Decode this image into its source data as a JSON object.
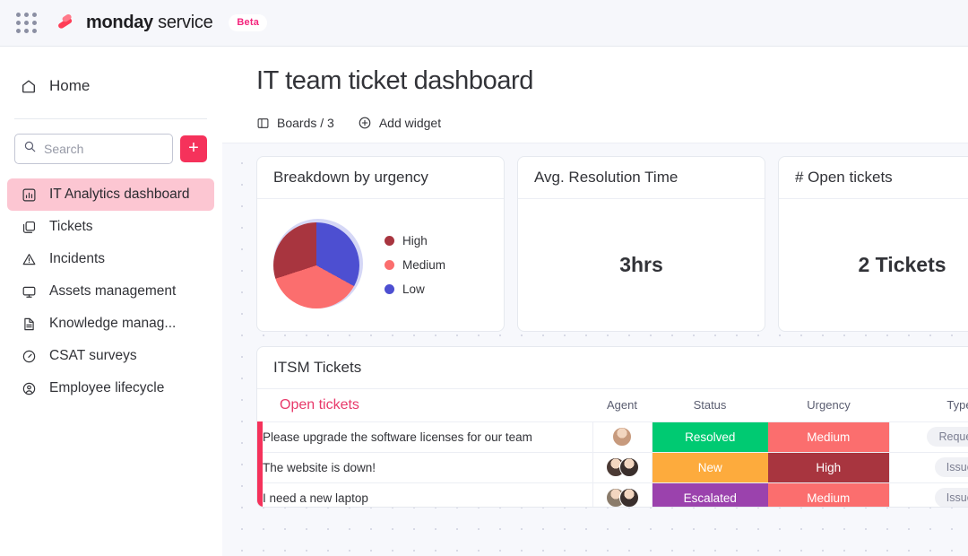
{
  "topbar": {
    "apps_icon": "app-grid-icon",
    "logo_icon": "monday-logo-icon",
    "brand_bold": "monday",
    "brand_light": " service",
    "beta_label": "Beta"
  },
  "sidebar": {
    "home": {
      "label": "Home",
      "icon": "home-icon"
    },
    "search": {
      "placeholder": "Search",
      "value": "",
      "icon": "search-icon"
    },
    "add_button": {
      "label": "+",
      "color": "#f5325b"
    },
    "items": [
      {
        "label": "IT Analytics dashboard",
        "icon": "bar-chart-icon",
        "active": true
      },
      {
        "label": "Tickets",
        "icon": "boards-stack-icon",
        "active": false
      },
      {
        "label": "Incidents",
        "icon": "warning-triangle-icon",
        "active": false
      },
      {
        "label": "Assets management",
        "icon": "monitor-icon",
        "active": false
      },
      {
        "label": "Knowledge manag...",
        "icon": "document-icon",
        "active": false
      },
      {
        "label": "CSAT surveys",
        "icon": "gauge-icon",
        "active": false
      },
      {
        "label": "Employee lifecycle",
        "icon": "person-circle-icon",
        "active": false
      }
    ]
  },
  "header": {
    "title": "IT team ticket dashboard",
    "tools": [
      {
        "label": "Boards / 3",
        "icon": "board-panel-icon"
      },
      {
        "label": "Add widget",
        "icon": "plus-circle-icon"
      }
    ]
  },
  "widgets": {
    "pie": {
      "title": "Breakdown by urgency"
    },
    "resolution": {
      "title": "Avg. Resolution Time",
      "value": "3hrs"
    },
    "open_tickets": {
      "title": "# Open tickets",
      "value": "2 Tickets"
    },
    "table": {
      "title": "ITSM Tickets"
    }
  },
  "chart_data": {
    "type": "pie",
    "title": "Breakdown by urgency",
    "labels": [
      "High",
      "Medium",
      "Low"
    ],
    "values": [
      30,
      37,
      33
    ],
    "colors": [
      "#a8353f",
      "#fb6e6e",
      "#4d4fd1"
    ],
    "legend_position": "right",
    "start_angle": 0,
    "slice_order": [
      "Low",
      "Medium",
      "High"
    ]
  },
  "table": {
    "group_label": "Open tickets",
    "columns": [
      "Open tickets",
      "Agent",
      "Status",
      "Urgency",
      "Type"
    ],
    "rows": [
      {
        "title": "Please upgrade the software licenses for our team",
        "agents": [
          "#c79a7d"
        ],
        "status": {
          "label": "Resolved",
          "color": "#00ca72"
        },
        "urgency": {
          "label": "Medium",
          "color": "#fb6e6e"
        },
        "type": "Request"
      },
      {
        "title": "The website is down!",
        "agents": [
          "#4b3a34",
          "#3a2f2c"
        ],
        "status": {
          "label": "New",
          "color": "#fdab3d"
        },
        "urgency": {
          "label": "High",
          "color": "#a8353f"
        },
        "type": "Issue"
      },
      {
        "title": "I need a new laptop",
        "agents": [
          "#8a7b6a",
          "#3a2f2c"
        ],
        "status": {
          "label": "Escalated",
          "color": "#9b42ad"
        },
        "urgency": {
          "label": "Medium",
          "color": "#fb6e6e"
        },
        "type": "Issue"
      }
    ]
  }
}
